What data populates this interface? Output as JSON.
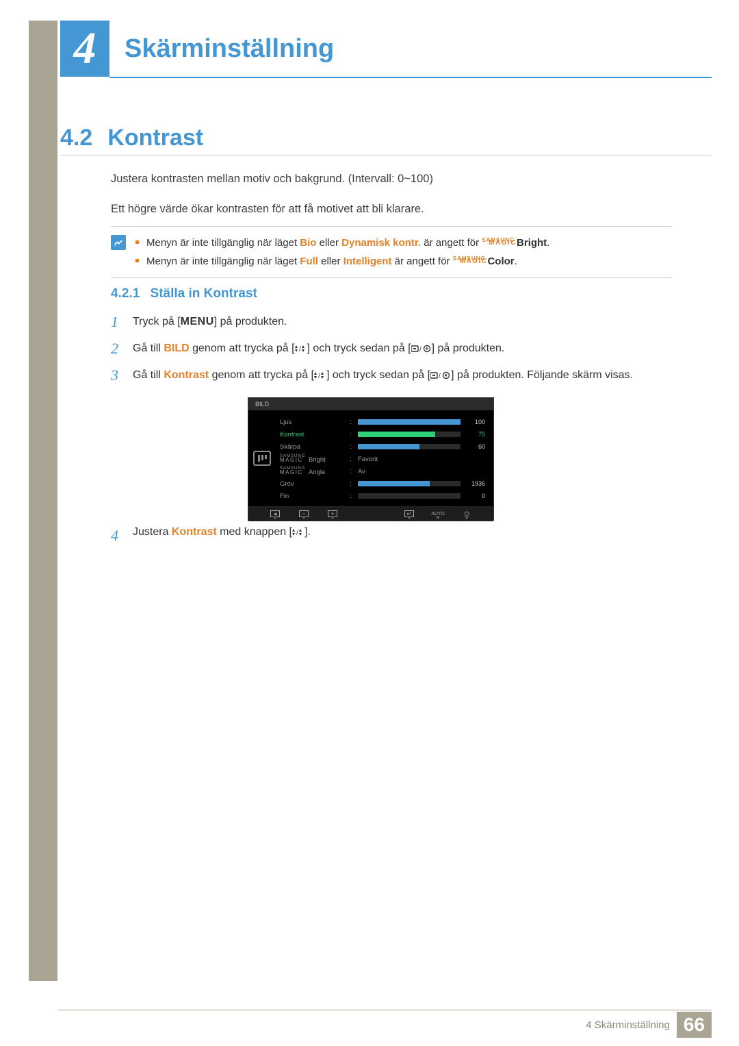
{
  "header": {
    "chapter_number": "4",
    "chapter_title": "Skärminställning"
  },
  "section": {
    "number": "4.2",
    "title": "Kontrast",
    "intro_1": "Justera kontrasten mellan motiv och bakgrund. (Intervall: 0~100)",
    "intro_2": "Ett högre värde ökar kontrasten för att få motivet att bli klarare."
  },
  "note": {
    "items": [
      {
        "pre": "Menyn är inte tillgänglig när läget ",
        "kw1": "Bio",
        "mid": " eller ",
        "kw2": "Dynamisk kontr.",
        "post": " är angett för ",
        "brand_sup": "SAMSUNG",
        "brand_main": "MAGIC",
        "brand_suffix": "Bright",
        "end": "."
      },
      {
        "pre": "Menyn är inte tillgänglig när läget ",
        "kw1": "Full",
        "mid": " eller ",
        "kw2": "Intelligent",
        "post": " är angett för ",
        "brand_sup": "SAMSUNG",
        "brand_main": "MAGIC",
        "brand_suffix": "Color",
        "end": "."
      }
    ]
  },
  "subsection": {
    "number": "4.2.1",
    "title": "Ställa in Kontrast"
  },
  "steps": {
    "s1": {
      "num": "1",
      "pre": "Tryck på [",
      "key": "MENU",
      "post": "] på produkten."
    },
    "s2": {
      "num": "2",
      "pre": "Gå till ",
      "target": "BILD",
      "mid": " genom att trycka på [",
      "post1": "] och tryck sedan på [",
      "post2": "] på produkten."
    },
    "s3": {
      "num": "3",
      "pre": "Gå till ",
      "target": "Kontrast",
      "mid": " genom att trycka på [",
      "post1": "] och tryck sedan på [",
      "post2": "] på produkten. Följande skärm visas."
    },
    "s4": {
      "num": "4",
      "pre": "Justera ",
      "target": "Kontrast",
      "mid": " med knappen [",
      "post": "]."
    }
  },
  "osd": {
    "title": "BILD",
    "rows": {
      "ljus": {
        "label": "Ljus",
        "value": "100",
        "fill_pct": 100
      },
      "kontrast": {
        "label": "Kontrast",
        "value": "75",
        "fill_pct": 75
      },
      "skarpa": {
        "label": "Skärpa",
        "value": "60",
        "fill_pct": 60
      },
      "bright": {
        "brand_sup": "SAMSUNG",
        "brand_main": "MAGIC",
        "suffix": "Bright",
        "value": "Favorit"
      },
      "angle": {
        "brand_sup": "SAMSUNG",
        "brand_main": "MAGIC",
        "suffix": "Angle",
        "value": "Av"
      },
      "grov": {
        "label": "Grov",
        "value": "1936",
        "fill_pct": 70
      },
      "fin": {
        "label": "Fin",
        "value": "0",
        "fill_pct": 0
      }
    },
    "footer_auto": "AUTO"
  },
  "footer": {
    "text": "4 Skärminställning",
    "page": "66"
  }
}
